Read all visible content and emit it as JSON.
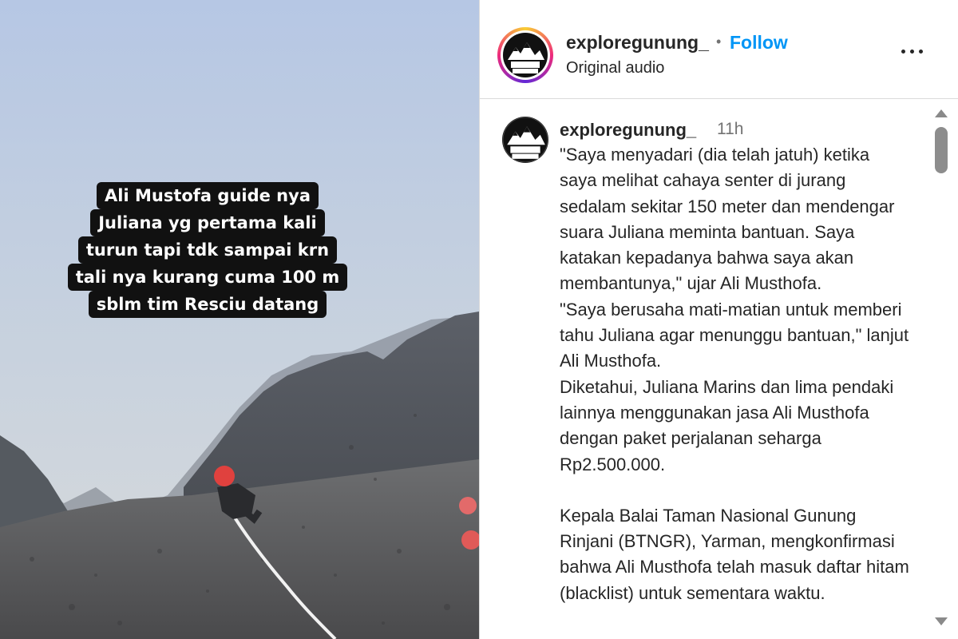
{
  "media": {
    "caption_lines": [
      "Ali Mustofa guide nya",
      "Juliana yg pertama kali",
      "turun tapi tdk sampai krn",
      "tali nya kurang cuma 100 m",
      "sblm tim Resciu datang"
    ]
  },
  "header": {
    "username": "exploregunung_",
    "separator": "•",
    "follow_label": "Follow",
    "audio": "Original audio",
    "more_icon": "more-horizontal-icon",
    "logo_text": "EXPLORE GUNUNG"
  },
  "comment": {
    "username": "exploregunung_",
    "time": "11h",
    "paragraphs": [
      "\"Saya menyadari (dia telah jatuh) ketika saya melihat cahaya senter di jurang sedalam sekitar 150 meter dan mendengar suara Juliana meminta bantuan. Saya katakan kepadanya bahwa saya akan membantunya,\" ujar Ali Musthofa.",
      "\"Saya berusaha mati-matian untuk memberi tahu Juliana agar menunggu bantuan,\" lanjut Ali Musthofa.",
      "Diketahui, Juliana Marins dan lima pendaki lainnya menggunakan jasa Ali Musthofa dengan paket perjalanan seharga Rp2.500.000.",
      "",
      "Kepala Balai Taman Nasional Gunung Rinjani (BTNGR), Yarman, mengkonfirmasi bahwa Ali Musthofa telah masuk daftar hitam (blacklist) untuk sementara waktu."
    ]
  },
  "colors": {
    "follow": "#0095f6",
    "text": "#262626",
    "muted": "#737373",
    "border": "#dbdbdb"
  }
}
